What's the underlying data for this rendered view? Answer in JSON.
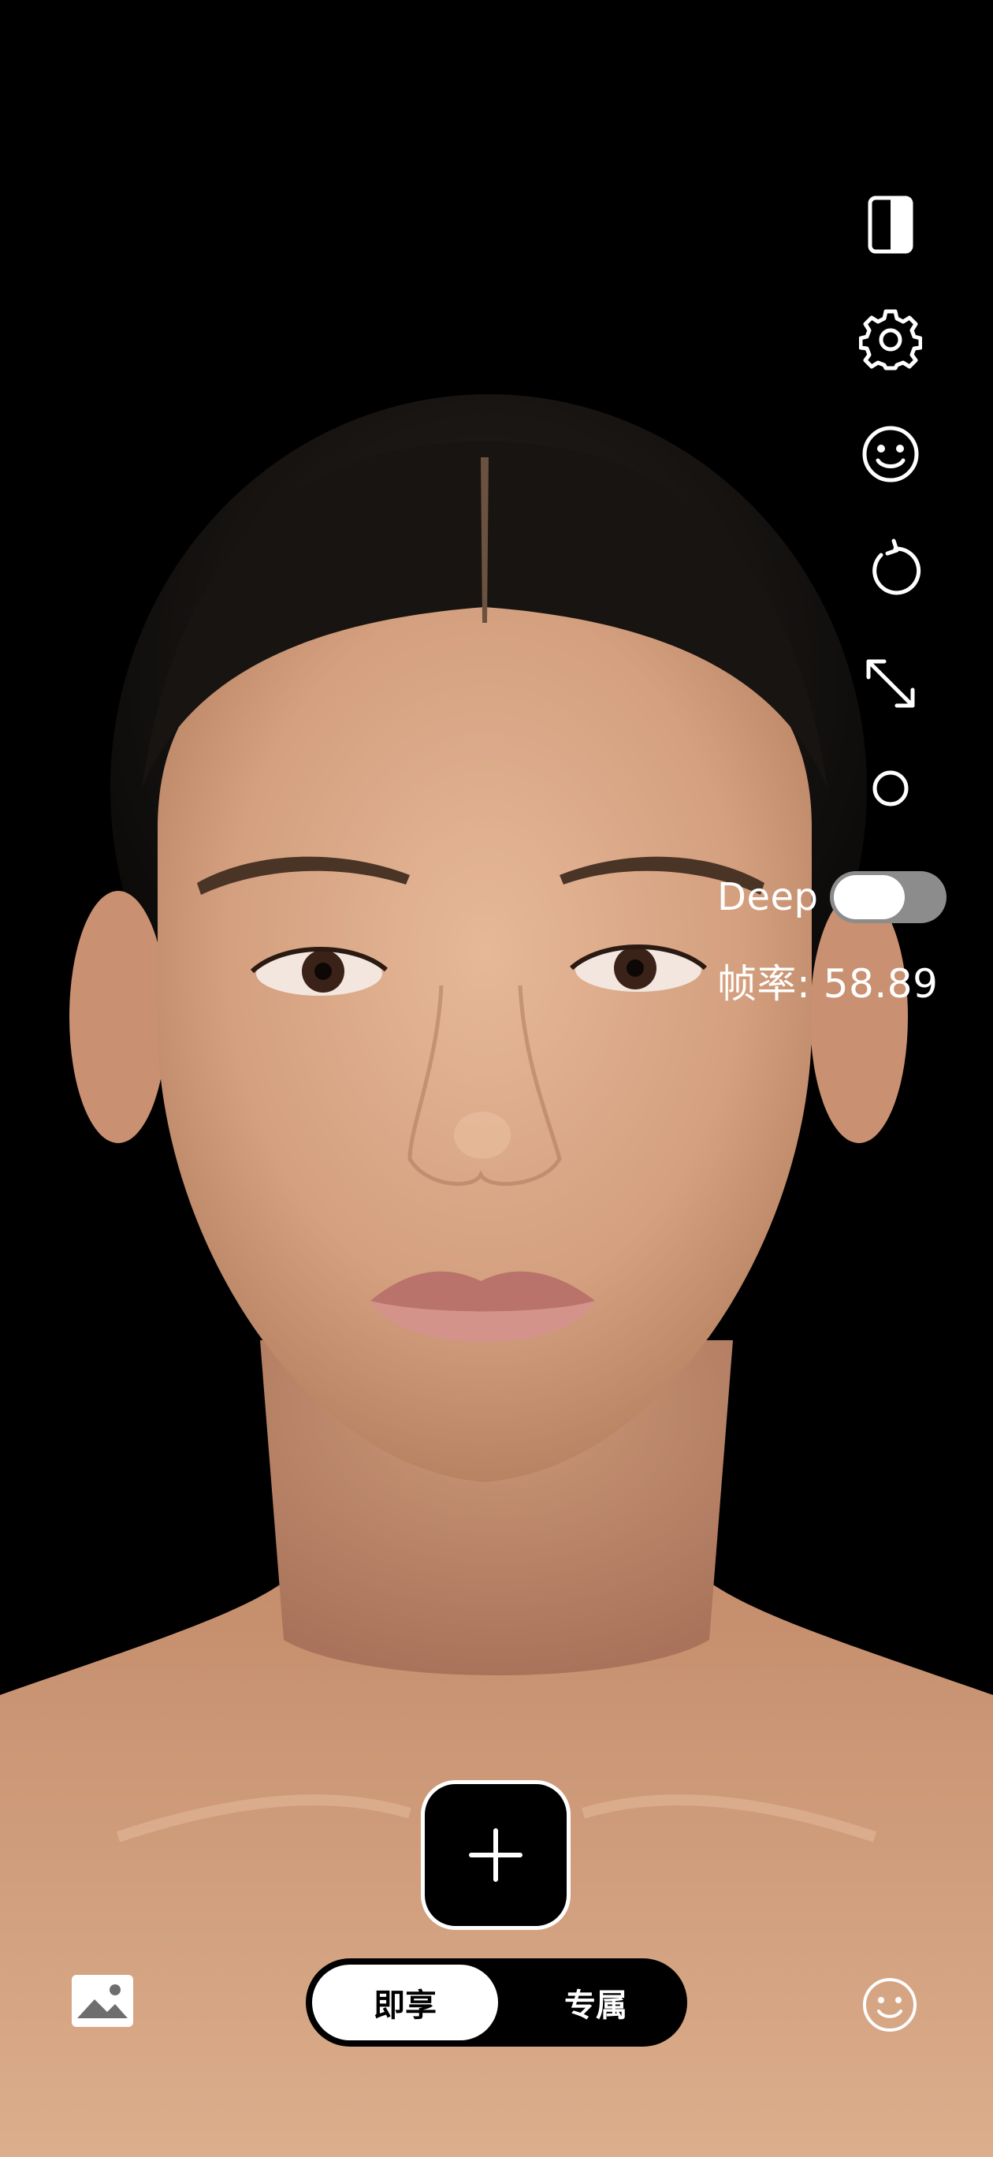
{
  "toolbar": {
    "items": [
      {
        "icon": "split-view-icon"
      },
      {
        "icon": "gear-icon"
      },
      {
        "icon": "smiley-face-icon"
      },
      {
        "icon": "rotate-icon"
      },
      {
        "icon": "expand-icon"
      },
      {
        "icon": "circle-icon"
      }
    ]
  },
  "deep": {
    "label": "Deep",
    "enabled": false
  },
  "fps": {
    "text": "帧率: 58.89"
  },
  "capture": {
    "icon": "plus-icon"
  },
  "modes": {
    "tabs": [
      {
        "label": "即享",
        "active": true
      },
      {
        "label": "专属",
        "active": false
      }
    ]
  },
  "bottom": {
    "left_icon": "gallery-icon",
    "right_icon": "smiley-face-icon"
  },
  "colors": {
    "background": "#000000",
    "icon": "#ffffff",
    "toggle_track": "#8c8c8c"
  }
}
